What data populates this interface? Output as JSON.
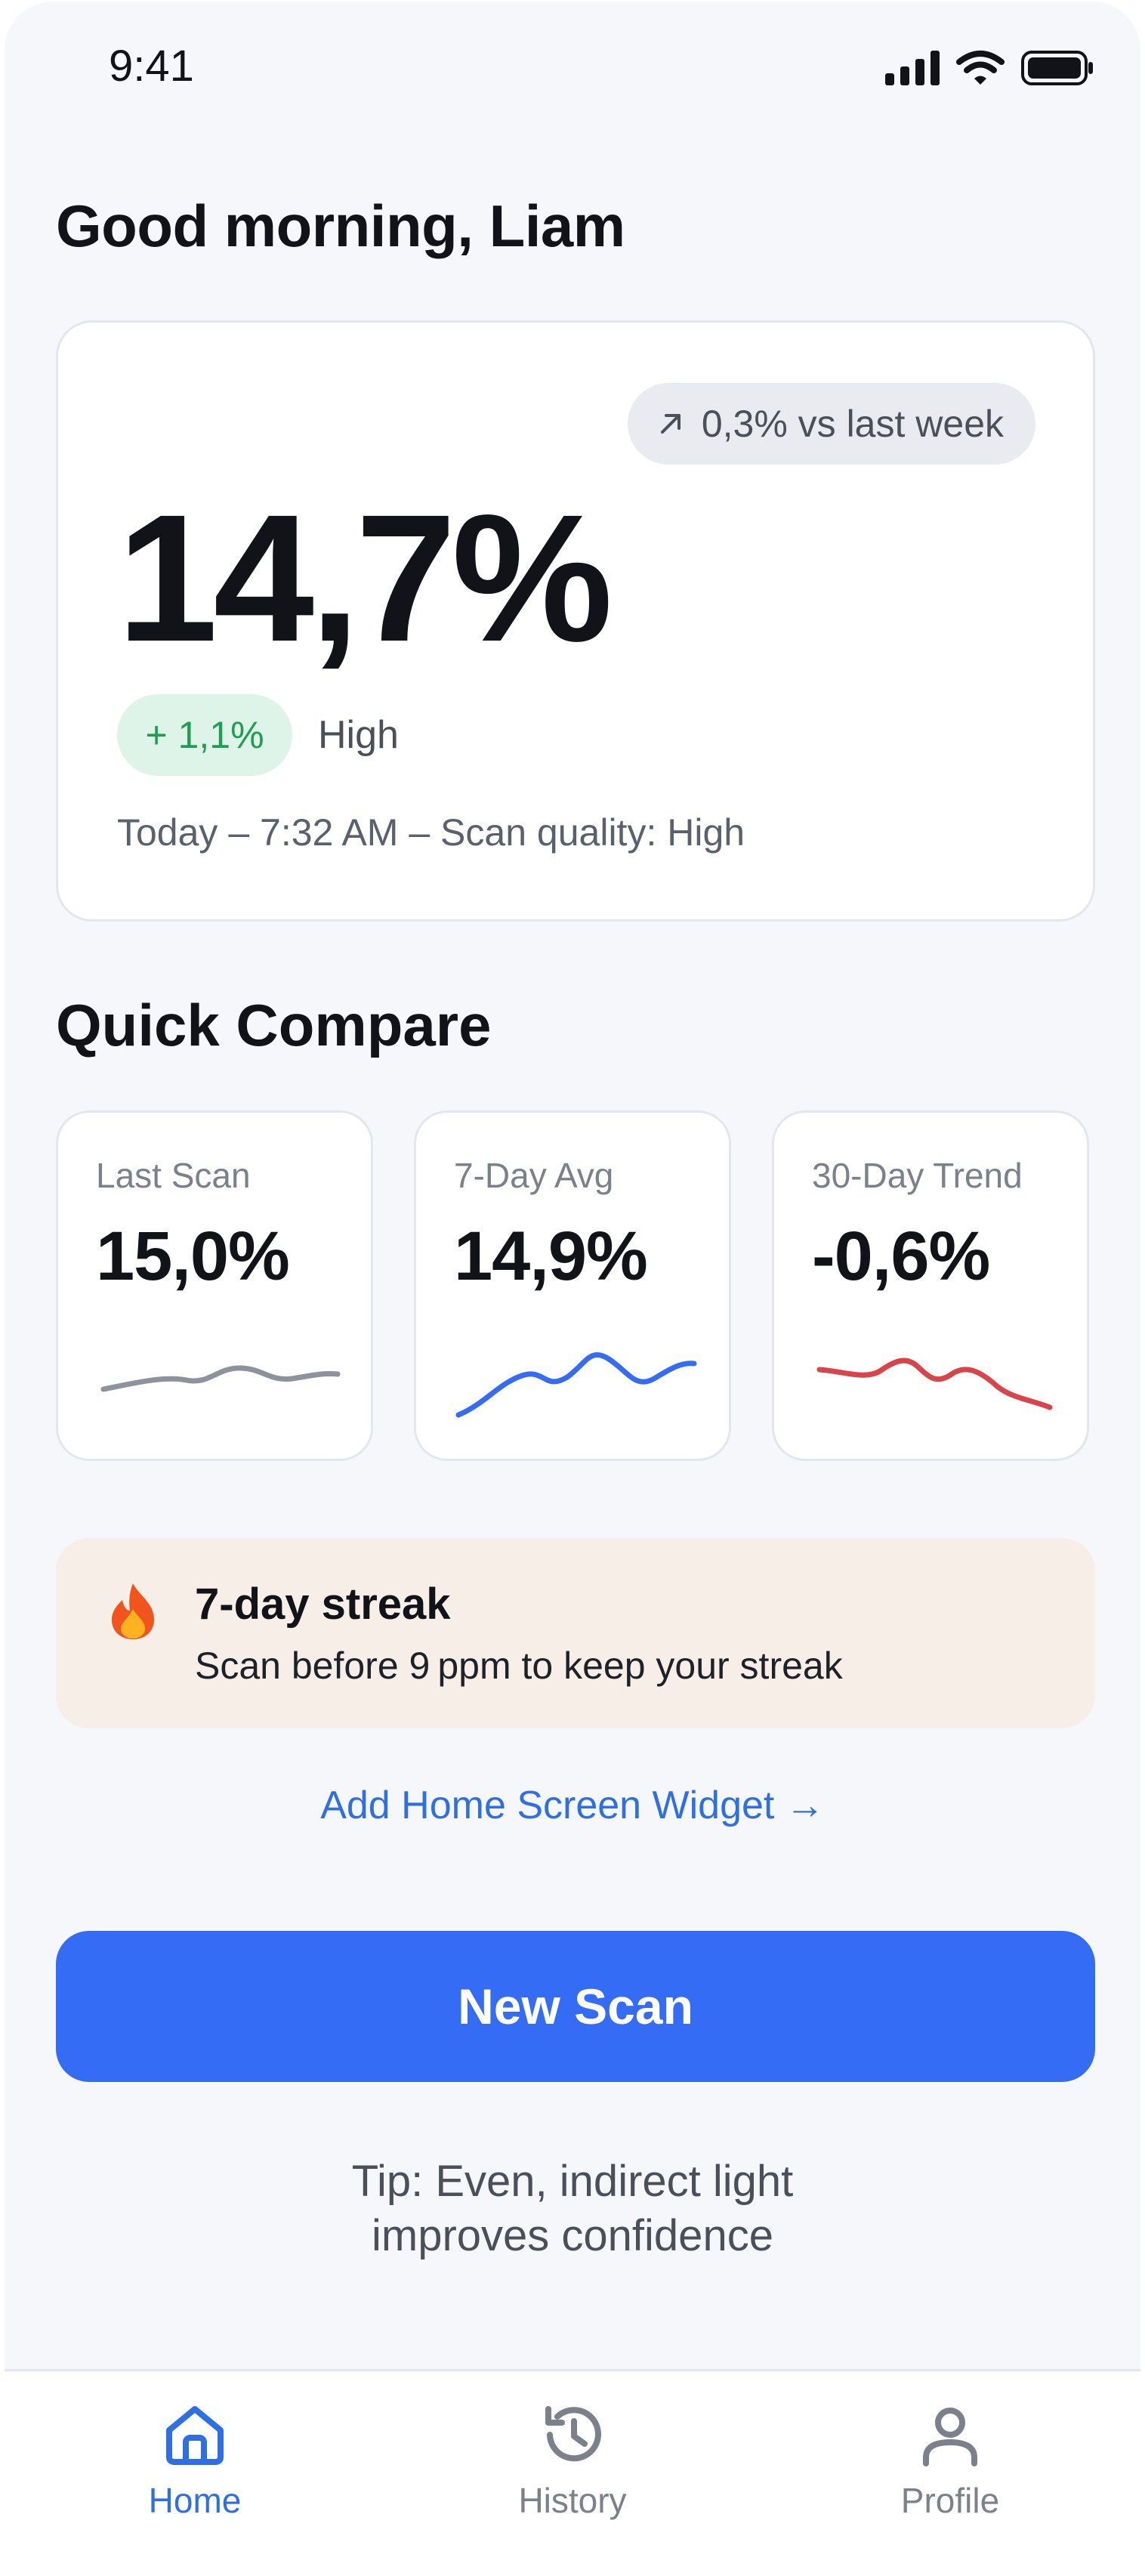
{
  "status_bar": {
    "time": "9:41"
  },
  "greeting": "Good morning, Liam",
  "hero": {
    "week_change": "0,3% vs last week",
    "value": "14,7%",
    "delta": "+ 1,1%",
    "delta_label": "High",
    "meta": "Today – 7:32 AM – Scan quality: High"
  },
  "quick_compare": {
    "title": "Quick Compare",
    "cards": [
      {
        "label": "Last Scan",
        "value": "15,0%",
        "color": "#8d929c"
      },
      {
        "label": "7-Day Avg",
        "value": "14,9%",
        "color": "#356cf5"
      },
      {
        "label": "30-Day Trend",
        "value": "-0,6%",
        "color": "#d9434a"
      }
    ]
  },
  "streak": {
    "icon": "fire-icon",
    "title": "7-day streak",
    "subtitle": "Scan before 9 ppm to keep your streak"
  },
  "widget_link": "Add Home Screen Widget →",
  "cta_label": "New Scan",
  "tip": [
    "Tip: Even, indirect light",
    "improves confidence"
  ],
  "tabs": [
    {
      "label": "Home",
      "icon": "home-icon",
      "active": true
    },
    {
      "label": "History",
      "icon": "history-icon",
      "active": false
    },
    {
      "label": "Profile",
      "icon": "profile-icon",
      "active": false
    }
  ],
  "colors": {
    "accent": "#356cf5",
    "success": "#1f9d55",
    "danger": "#d9434a"
  }
}
